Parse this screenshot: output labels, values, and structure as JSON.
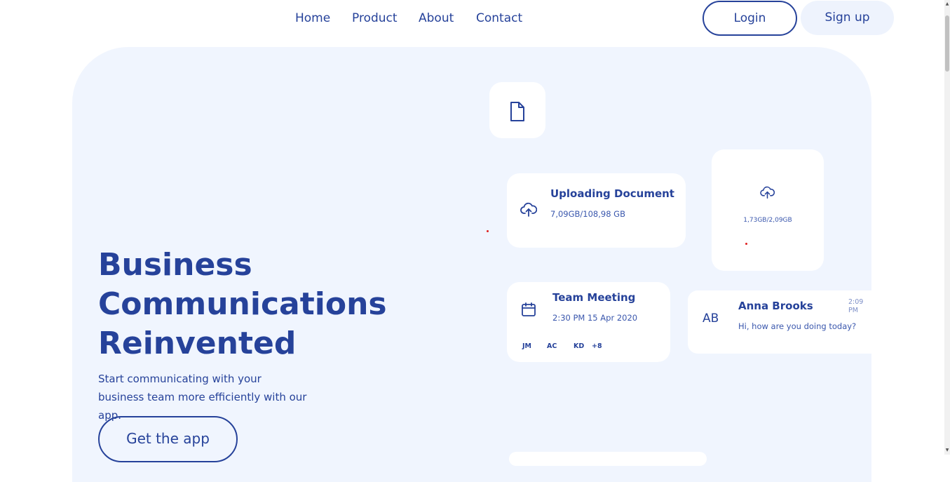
{
  "nav": {
    "links": [
      "Home",
      "Product",
      "About",
      "Contact"
    ],
    "login_label": "Login",
    "signup_label": "Sign up"
  },
  "hero": {
    "title_lines": [
      "Business",
      "Communications",
      "Reinvented"
    ],
    "subtitle": "Start communicating with your business team more efficiently with our app.",
    "cta_label": "Get the app"
  },
  "cards": {
    "document": {
      "icon": "document-icon"
    },
    "upload": {
      "icon": "cloud-upload-icon",
      "title": "Uploading Document",
      "progress": "7,09GB/108,98 GB"
    },
    "small_upload": {
      "icon": "cloud-upload-icon",
      "progress": "1,73GB/2,09GB"
    },
    "meeting": {
      "icon": "calendar-icon",
      "title": "Team Meeting",
      "datetime": "2:30 PM 15 Apr 2020",
      "attendees": [
        "JM",
        "AC",
        "KD",
        "+8"
      ]
    },
    "message": {
      "avatar": "AB",
      "name": "Anna Brooks",
      "time": "2:09 PM",
      "text": "Hi, how are you doing today?"
    }
  },
  "colors": {
    "primary": "#26429a",
    "hero_bg": "#f0f5fe",
    "card_bg": "#ffffff",
    "signup_bg": "#eef3fd"
  }
}
